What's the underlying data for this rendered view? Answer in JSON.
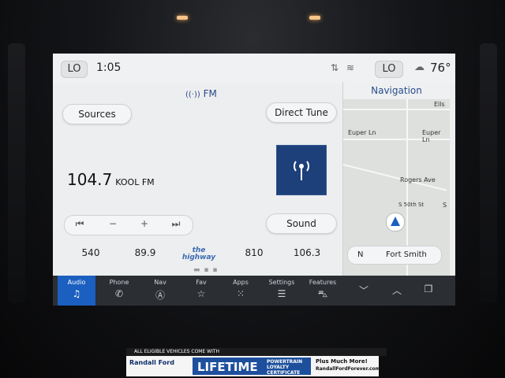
{
  "status": {
    "lo_left": "LO",
    "time": "1:05",
    "lo_right": "LO",
    "temperature": "76°"
  },
  "radio": {
    "band": "FM",
    "sources_label": "Sources",
    "direct_tune_label": "Direct Tune",
    "frequency": "104.7",
    "station_name": "KOOL FM",
    "sound_label": "Sound",
    "controls": [
      "⏮",
      "−",
      "+",
      "⏭"
    ],
    "presets": [
      "540",
      "89.9",
      "the highway",
      "810",
      "106.3"
    ]
  },
  "navigation": {
    "title": "Navigation",
    "streets": [
      "Ells",
      "Euper Ln",
      "Euper Ln",
      "Rogers Ave",
      "S 50th St",
      "S"
    ],
    "heading": "N",
    "city": "Fort Smith"
  },
  "tabs": [
    {
      "label": "Audio",
      "icon": "music-note-icon",
      "active": true
    },
    {
      "label": "Phone",
      "icon": "phone-icon"
    },
    {
      "label": "Nav",
      "icon": "compass-icon"
    },
    {
      "label": "Fav",
      "icon": "star-icon"
    },
    {
      "label": "Apps",
      "icon": "apps-grid-icon"
    },
    {
      "label": "Settings",
      "icon": "sliders-icon"
    },
    {
      "label": "Features",
      "icon": "car-icon"
    }
  ],
  "banner": {
    "top": "ALL ELIGIBLE VEHICLES COME WITH",
    "dealer": "Randall Ford",
    "lifetime": "LIFETIME",
    "cert": "POWERTRAIN LOYALTY CERTIFICATE",
    "more": "Plus Much More!",
    "url": "RandallFordForever.com"
  }
}
